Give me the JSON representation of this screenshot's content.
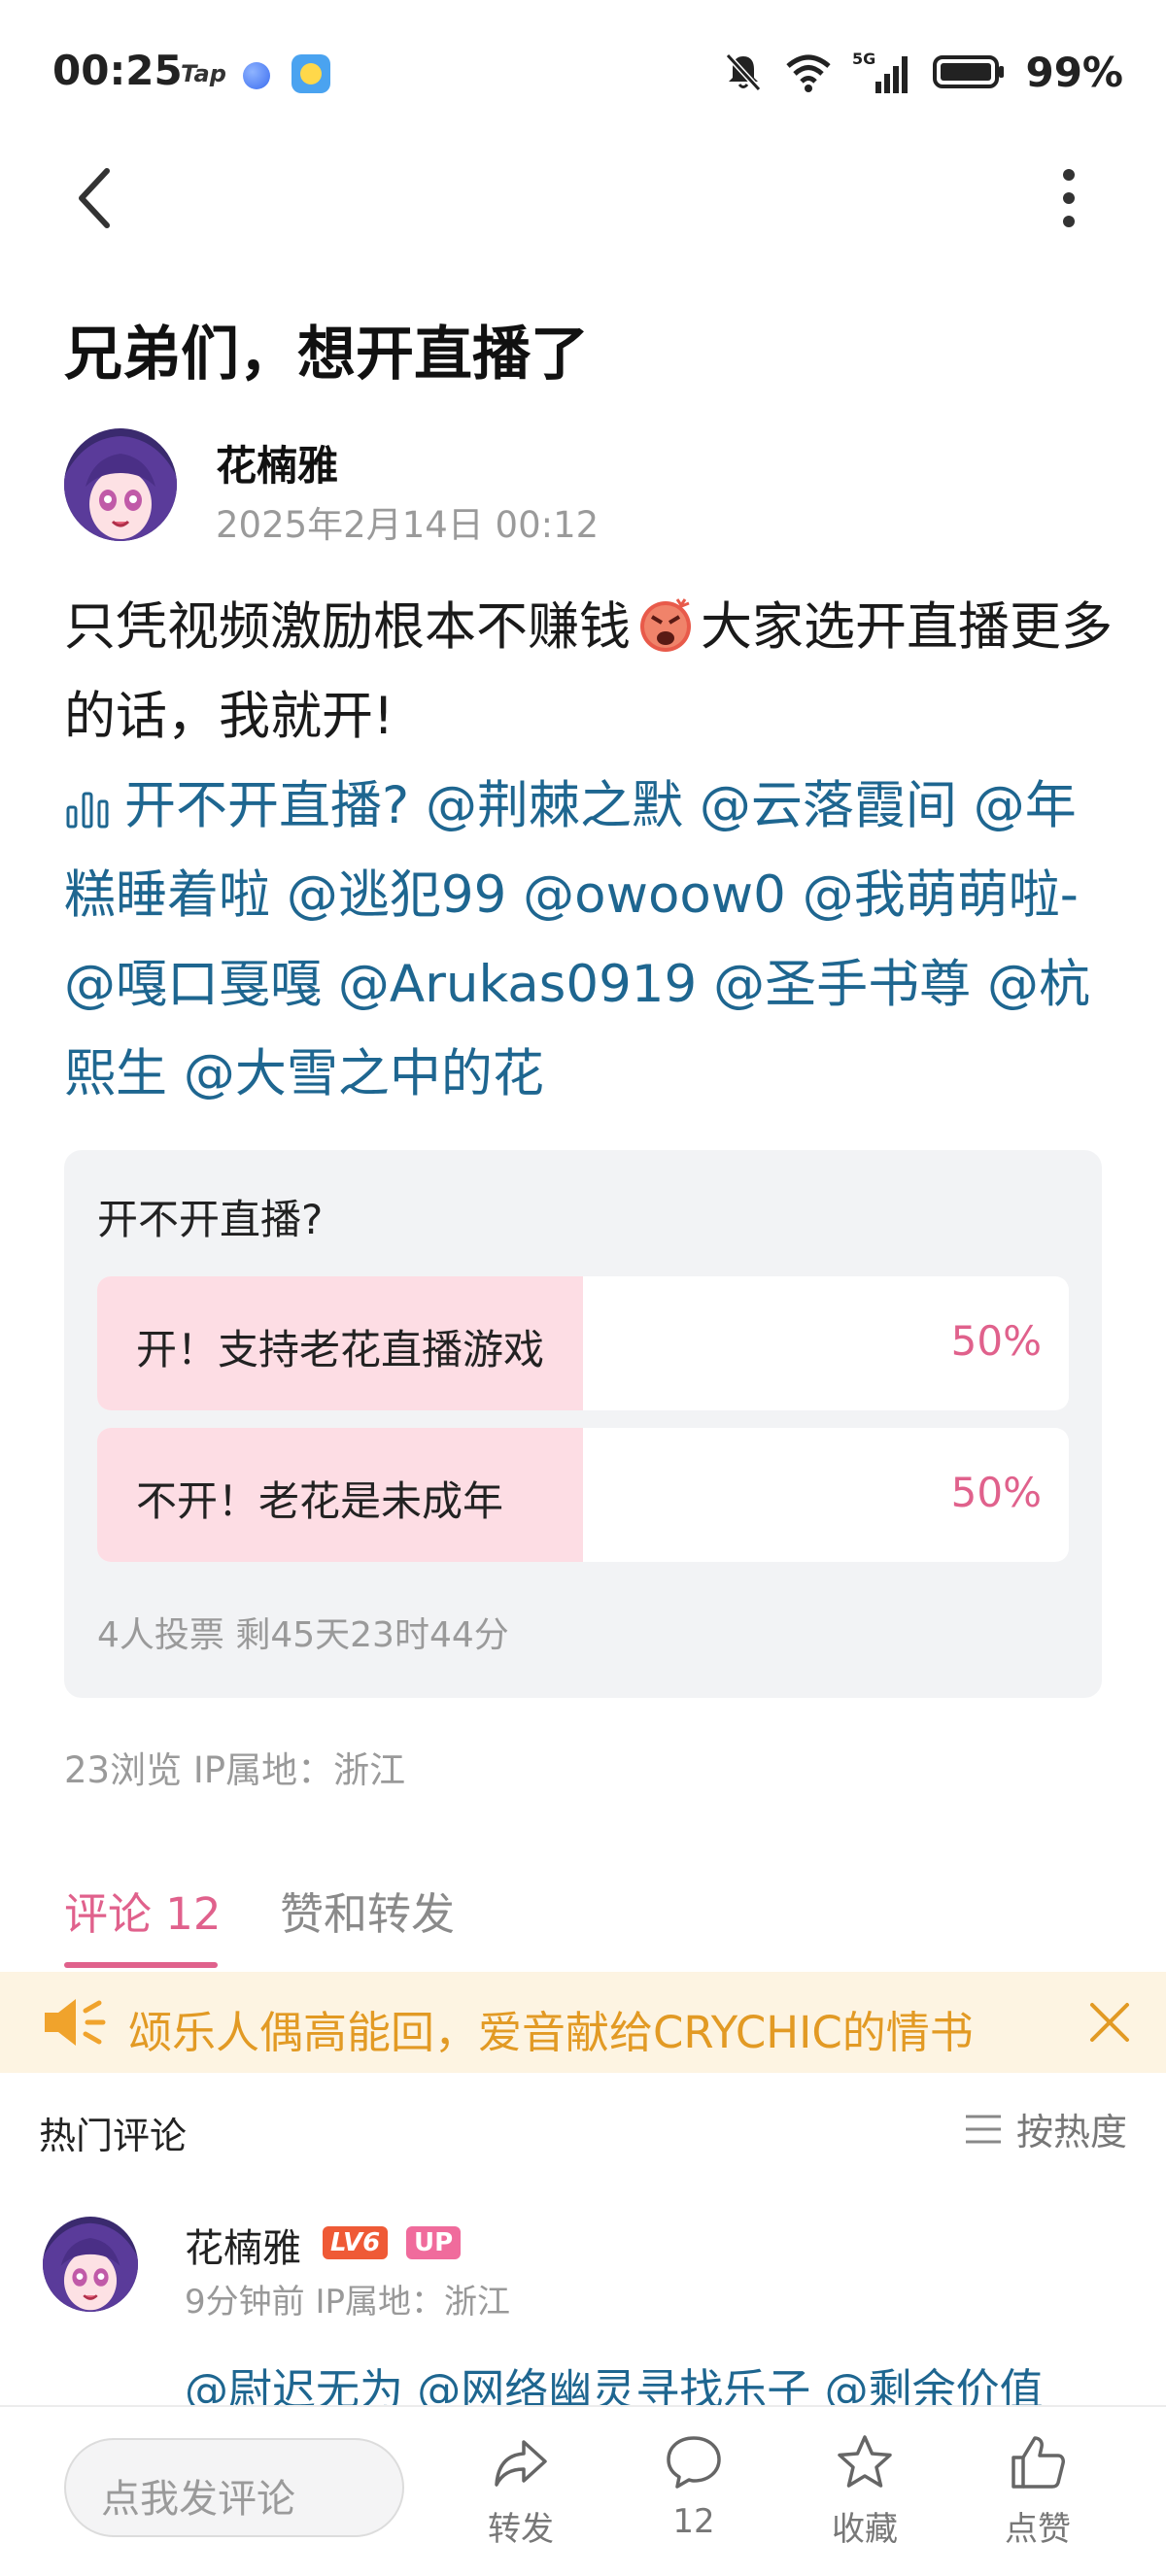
{
  "status_bar": {
    "time": "00:25",
    "tap_label": "Tap",
    "battery": "99%",
    "network": "5G"
  },
  "post": {
    "title": "兄弟们，想开直播了",
    "author": "花楠雅",
    "date": "2025年2月14日 00:12",
    "body_line1_a": "只凭视频激励根本不赚钱",
    "body_line1_b": "大家选开直播更多的话，我就开!",
    "poll_link": "开不开直播?",
    "mentions": [
      "@荆棘之默",
      "@云落霞间",
      "@年糕睡着啦",
      "@逃犯99",
      "@owoow0",
      "@我萌萌啦-",
      "@嘎口戛嘎",
      "@Arukas0919",
      "@圣手书尊",
      "@杭熙生",
      "@大雪之中的花"
    ],
    "meta": "23浏览   IP属地：浙江"
  },
  "poll": {
    "question": "开不开直播?",
    "options": [
      {
        "label": "开！支持老花直播游戏",
        "percent": "50%",
        "fraction": 0.5
      },
      {
        "label": "不开！老花是未成年",
        "percent": "50%",
        "fraction": 0.5
      }
    ],
    "footer": "4人投票 剩45天23时44分"
  },
  "tabs": {
    "comments": "评论 12",
    "likes": "赞和转发"
  },
  "banner": {
    "text": "颂乐人偶高能回，爱音献给CRYCHIC的情书"
  },
  "comments_section": {
    "title": "热门评论",
    "sort_label": "按热度"
  },
  "comment": {
    "author": "花楠雅",
    "level": "LV6",
    "up_badge": "UP",
    "time": "9分钟前 IP属地：浙江",
    "text": "@尉迟无为 @网络幽灵寻找乐子 @剩余价值"
  },
  "bottom_bar": {
    "input_placeholder": "点我发评论",
    "repost": "转发",
    "comments_count": "12",
    "favorite": "收藏",
    "like": "点赞"
  },
  "colors": {
    "accent": "#e0618c",
    "link": "#1e6690",
    "banner_text": "#e29a24",
    "banner_bg": "#fdf4e2",
    "poll_fill": "#fddde4"
  }
}
